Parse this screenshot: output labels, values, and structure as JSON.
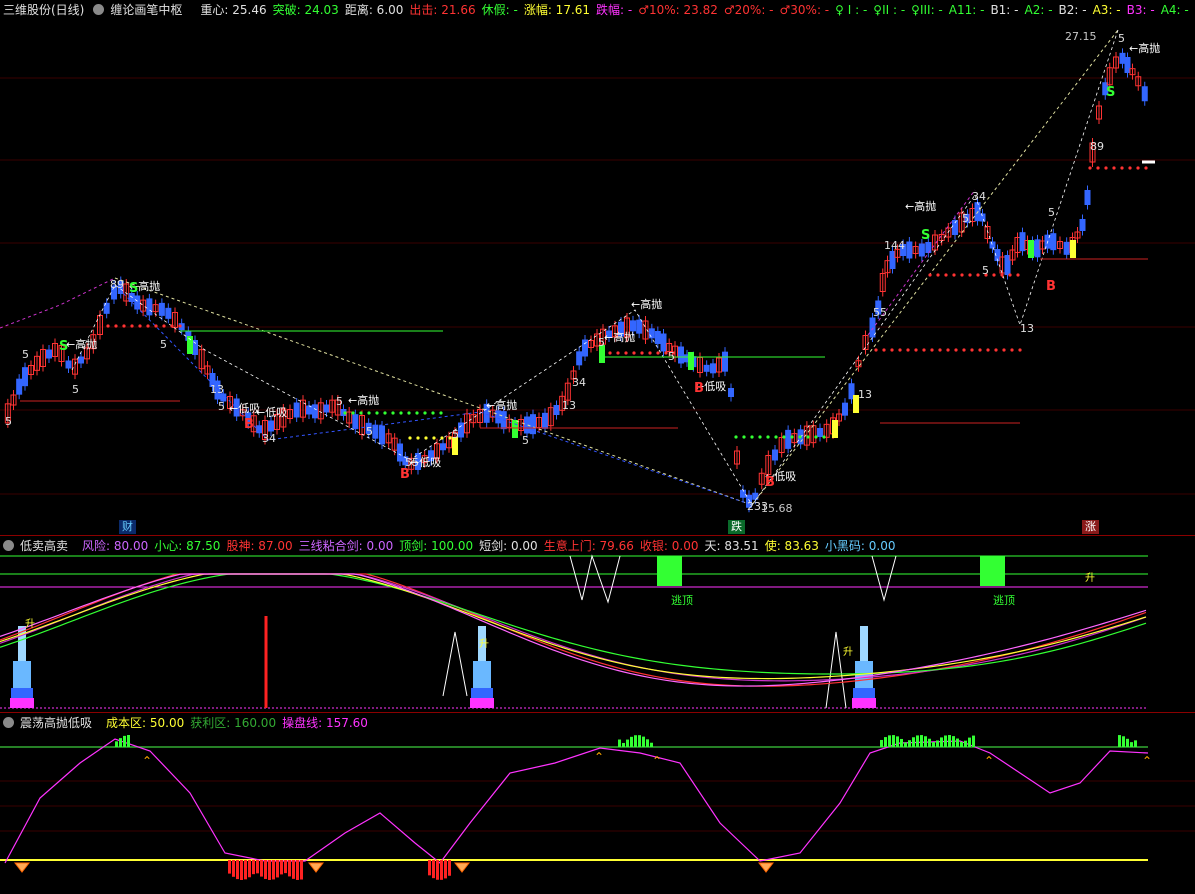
{
  "main_header": {
    "title": "三维股份(日线)",
    "indicator": "缠论画笔中枢",
    "items": [
      {
        "text": "重心: 25.46",
        "color": "#e0e0e0"
      },
      {
        "text": "突破: 24.03",
        "color": "#33ff33"
      },
      {
        "text": "距离: 6.00",
        "color": "#e0e0e0"
      },
      {
        "text": "出击: 21.66",
        "color": "#ff3333"
      },
      {
        "text": "休假: -",
        "color": "#33ff33"
      },
      {
        "text": "涨幅: 17.61",
        "color": "#ffff33"
      },
      {
        "text": "跌幅: -",
        "color": "#ff33ff"
      },
      {
        "text": "♂10%: 23.82",
        "color": "#ff3333"
      },
      {
        "text": "♂20%: -",
        "color": "#ff3333"
      },
      {
        "text": "♂30%: -",
        "color": "#ff3333"
      },
      {
        "text": "♀ I : -",
        "color": "#33ff33"
      },
      {
        "text": "♀II : -",
        "color": "#33ff33"
      },
      {
        "text": "♀III: -",
        "color": "#33ff33"
      },
      {
        "text": "A11: -",
        "color": "#33ff33"
      },
      {
        "text": "B1: -",
        "color": "#e0e0e0"
      },
      {
        "text": "A2: -",
        "color": "#33ff33"
      },
      {
        "text": "B2: -",
        "color": "#e0e0e0"
      },
      {
        "text": "A3: -",
        "color": "#ffff33"
      },
      {
        "text": "B3: -",
        "color": "#ff33ff"
      },
      {
        "text": "A4: -",
        "color": "#33ff33"
      },
      {
        "text": "B4: -",
        "color": "#e0e0e0"
      }
    ]
  },
  "main_chart": {
    "price_labels": {
      "high": "27.15",
      "low": "15.68"
    },
    "signals": [
      "←高抛",
      "←高抛",
      "←高抛",
      "←高抛",
      "←高抛",
      "←高抛",
      "←高抛",
      "←高抛",
      "←低吸",
      "←低吸",
      "←低吸",
      "←低吸",
      "←低吸"
    ],
    "letters": {
      "buy": "B",
      "sell": "S"
    },
    "bottom_tags": [
      "财",
      "跌",
      "涨"
    ]
  },
  "pane2_header": {
    "title": "低卖高卖",
    "items": [
      {
        "text": "风险: 80.00",
        "color": "#cc66ff"
      },
      {
        "text": "小心: 87.50",
        "color": "#33ff33"
      },
      {
        "text": "股神: 87.00",
        "color": "#ff3333"
      },
      {
        "text": "三线粘合剑: 0.00",
        "color": "#cc66ff"
      },
      {
        "text": "顶剑: 100.00",
        "color": "#33ff33"
      },
      {
        "text": "短剑: 0.00",
        "color": "#e0e0e0"
      },
      {
        "text": "生意上门: 79.66",
        "color": "#ff3333"
      },
      {
        "text": "收银: 0.00",
        "color": "#ff3333"
      },
      {
        "text": "天: 83.51",
        "color": "#e0e0e0"
      },
      {
        "text": "使: 83.63",
        "color": "#ffff33"
      },
      {
        "text": "小黑码: 0.00",
        "color": "#66ccff"
      }
    ],
    "labels": [
      "逃顶",
      "逃顶",
      "升",
      "升",
      "升",
      "升"
    ]
  },
  "pane3_header": {
    "title": "震荡高抛低吸",
    "items": [
      {
        "text": "成本区: 50.00",
        "color": "#ffff33"
      },
      {
        "text": "获利区: 160.00",
        "color": "#33aa33"
      },
      {
        "text": "操盘线: 157.60",
        "color": "#ff33ff"
      }
    ]
  },
  "colors": {
    "up": "#ff3333",
    "down": "#3366ff",
    "background": "#000000",
    "grid": "#3a0000",
    "purple": "#ff33ff",
    "yellow": "#ffff33",
    "green": "#33ff33",
    "cyan": "#66ccff"
  }
}
